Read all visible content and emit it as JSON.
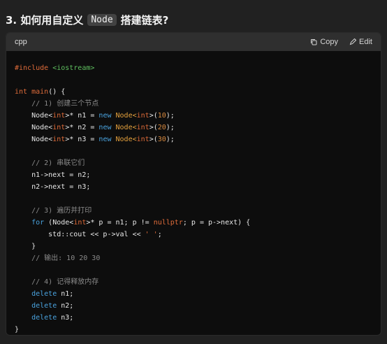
{
  "heading": {
    "prefix": "3. 如何用自定义",
    "code": "Node",
    "suffix": "搭建链表?"
  },
  "code_block": {
    "language": "cpp",
    "copy_label": "Copy",
    "edit_label": "Edit",
    "lines": [
      [
        {
          "t": "#include ",
          "c": "pre"
        },
        {
          "t": "<iostream>",
          "c": "inc"
        }
      ],
      [],
      [
        {
          "t": "int ",
          "c": "kw"
        },
        {
          "t": "main",
          "c": "kw"
        },
        {
          "t": "() {",
          "c": "plain"
        }
      ],
      [
        {
          "t": "    // 1) 创建三个节点",
          "c": "com"
        }
      ],
      [
        {
          "t": "    Node<",
          "c": "plain"
        },
        {
          "t": "int",
          "c": "kw"
        },
        {
          "t": ">* n1 = ",
          "c": "plain"
        },
        {
          "t": "new ",
          "c": "new"
        },
        {
          "t": "Node<",
          "c": "type"
        },
        {
          "t": "int",
          "c": "kw"
        },
        {
          "t": ">(",
          "c": "plain"
        },
        {
          "t": "10",
          "c": "num"
        },
        {
          "t": ");",
          "c": "plain"
        }
      ],
      [
        {
          "t": "    Node<",
          "c": "plain"
        },
        {
          "t": "int",
          "c": "kw"
        },
        {
          "t": ">* n2 = ",
          "c": "plain"
        },
        {
          "t": "new ",
          "c": "new"
        },
        {
          "t": "Node<",
          "c": "type"
        },
        {
          "t": "int",
          "c": "kw"
        },
        {
          "t": ">(",
          "c": "plain"
        },
        {
          "t": "20",
          "c": "num"
        },
        {
          "t": ");",
          "c": "plain"
        }
      ],
      [
        {
          "t": "    Node<",
          "c": "plain"
        },
        {
          "t": "int",
          "c": "kw"
        },
        {
          "t": ">* n3 = ",
          "c": "plain"
        },
        {
          "t": "new ",
          "c": "new"
        },
        {
          "t": "Node<",
          "c": "type"
        },
        {
          "t": "int",
          "c": "kw"
        },
        {
          "t": ">(",
          "c": "plain"
        },
        {
          "t": "30",
          "c": "num"
        },
        {
          "t": ");",
          "c": "plain"
        }
      ],
      [],
      [
        {
          "t": "    // 2) 串联它们",
          "c": "com"
        }
      ],
      [
        {
          "t": "    n1->next = n2;",
          "c": "plain"
        }
      ],
      [
        {
          "t": "    n2->next = n3;",
          "c": "plain"
        }
      ],
      [],
      [
        {
          "t": "    // 3) 遍历并打印",
          "c": "com"
        }
      ],
      [
        {
          "t": "    ",
          "c": "plain"
        },
        {
          "t": "for",
          "c": "new"
        },
        {
          "t": " (Node<",
          "c": "plain"
        },
        {
          "t": "int",
          "c": "kw"
        },
        {
          "t": ">* p = n1; p != ",
          "c": "plain"
        },
        {
          "t": "nullptr",
          "c": "kw"
        },
        {
          "t": "; p = p->next) {",
          "c": "plain"
        }
      ],
      [
        {
          "t": "        std::cout << p->val << ",
          "c": "plain"
        },
        {
          "t": "' '",
          "c": "str"
        },
        {
          "t": ";",
          "c": "plain"
        }
      ],
      [
        {
          "t": "    }",
          "c": "plain"
        }
      ],
      [
        {
          "t": "    // 输出: 10 20 30",
          "c": "com"
        }
      ],
      [],
      [
        {
          "t": "    // 4) 记得释放内存",
          "c": "com"
        }
      ],
      [
        {
          "t": "    ",
          "c": "plain"
        },
        {
          "t": "delete",
          "c": "new"
        },
        {
          "t": " n1;",
          "c": "plain"
        }
      ],
      [
        {
          "t": "    ",
          "c": "plain"
        },
        {
          "t": "delete",
          "c": "new"
        },
        {
          "t": " n2;",
          "c": "plain"
        }
      ],
      [
        {
          "t": "    ",
          "c": "plain"
        },
        {
          "t": "delete",
          "c": "new"
        },
        {
          "t": " n3;",
          "c": "plain"
        }
      ],
      [
        {
          "t": "}",
          "c": "plain"
        }
      ]
    ]
  }
}
